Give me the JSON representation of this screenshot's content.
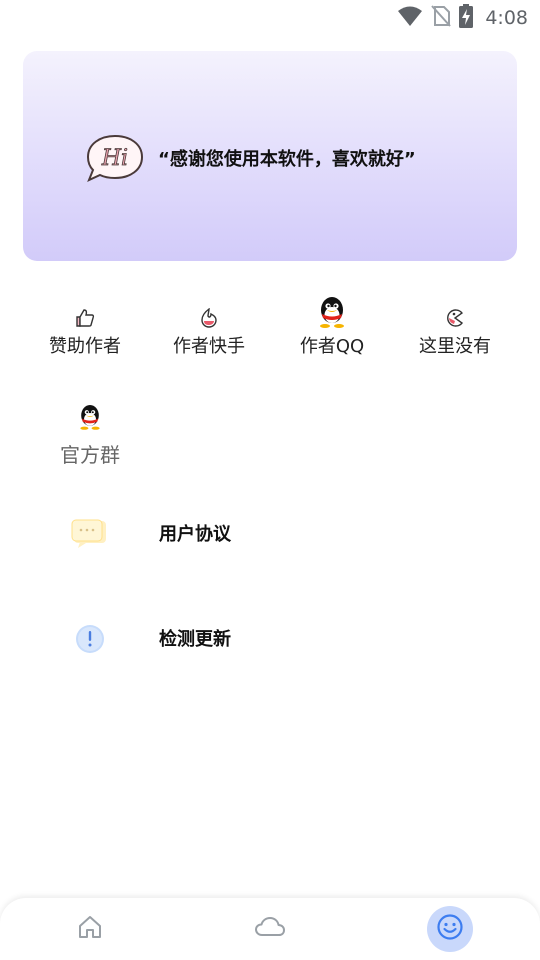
{
  "status_bar": {
    "time": "4:08",
    "icons": [
      "wifi-icon",
      "no-sim-icon",
      "battery-charging-icon"
    ]
  },
  "banner": {
    "icon": "hi-bubble-icon",
    "icon_text": "Hi",
    "text": "“感谢您使用本软件，喜欢就好”"
  },
  "grid": {
    "items": [
      {
        "label": "赞助作者",
        "icon": "thumbs-up-icon"
      },
      {
        "label": "作者快手",
        "icon": "kuaishou-icon"
      },
      {
        "label": "作者QQ",
        "icon": "qq-penguin-icon"
      },
      {
        "label": "这里没有",
        "icon": "pacman-icon"
      },
      {
        "label": "官方群",
        "icon": "qq-penguin-icon"
      }
    ]
  },
  "list": {
    "items": [
      {
        "label": "用户协议",
        "icon": "chat-bubble-icon"
      },
      {
        "label": "检测更新",
        "icon": "info-alert-icon"
      }
    ]
  },
  "bottom_nav": {
    "items": [
      {
        "name": "home",
        "icon": "home-icon",
        "active": false
      },
      {
        "name": "cloud",
        "icon": "cloud-icon",
        "active": false
      },
      {
        "name": "me",
        "icon": "smiley-icon",
        "active": true
      }
    ]
  },
  "colors": {
    "banner_top": "#f4f2fd",
    "banner_bottom": "#d2cbf9",
    "nav_active": "#c9d8fb",
    "nav_active_icon": "#3d7df0",
    "nav_inactive_icon": "#9aa0a6"
  }
}
